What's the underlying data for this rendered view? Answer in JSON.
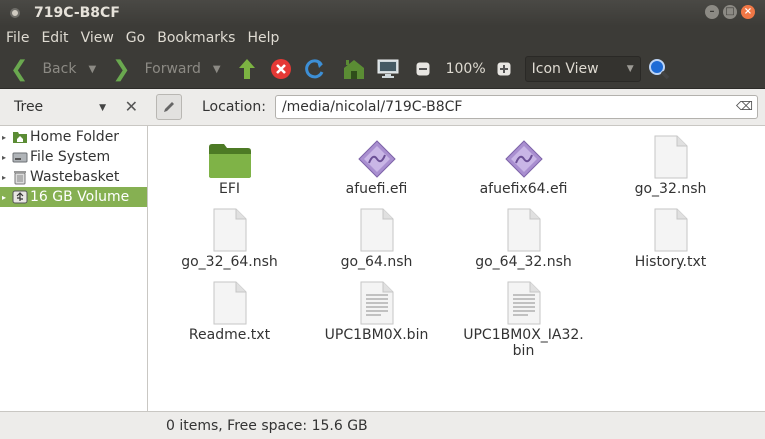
{
  "window": {
    "title": "719C-B8CF"
  },
  "menubar": {
    "items": [
      "File",
      "Edit",
      "View",
      "Go",
      "Bookmarks",
      "Help"
    ]
  },
  "toolbar": {
    "back_label": "Back",
    "forward_label": "Forward",
    "zoom": "100%",
    "view_mode": "Icon View"
  },
  "sidepane": {
    "mode_label": "Tree"
  },
  "location": {
    "label": "Location:",
    "path": "/media/nicolal/719C-B8CF"
  },
  "sidebar": {
    "items": [
      {
        "label": "Home Folder",
        "icon": "home-folder-icon"
      },
      {
        "label": "File System",
        "icon": "hard-drive-icon"
      },
      {
        "label": "Wastebasket",
        "icon": "trash-icon"
      },
      {
        "label": "16 GB Volume",
        "icon": "usb-drive-icon",
        "selected": true
      }
    ]
  },
  "files": [
    {
      "name": "EFI",
      "type": "folder"
    },
    {
      "name": "afuefi.efi",
      "type": "executable"
    },
    {
      "name": "afuefix64.efi",
      "type": "executable"
    },
    {
      "name": "go_32.nsh",
      "type": "blank"
    },
    {
      "name": "go_32_64.nsh",
      "type": "blank"
    },
    {
      "name": "go_64.nsh",
      "type": "blank"
    },
    {
      "name": "go_64_32.nsh",
      "type": "blank"
    },
    {
      "name": "History.txt",
      "type": "blank"
    },
    {
      "name": "Readme.txt",
      "type": "blank"
    },
    {
      "name": "UPC1BM0X.bin",
      "type": "binary"
    },
    {
      "name": "UPC1BM0X_IA32.\nbin",
      "type": "binary"
    }
  ],
  "status": {
    "text": "0 items, Free space: 15.6 GB"
  },
  "colors": {
    "selection": "#86b052",
    "titlebar": "#3c3b37",
    "close": "#f07746"
  }
}
